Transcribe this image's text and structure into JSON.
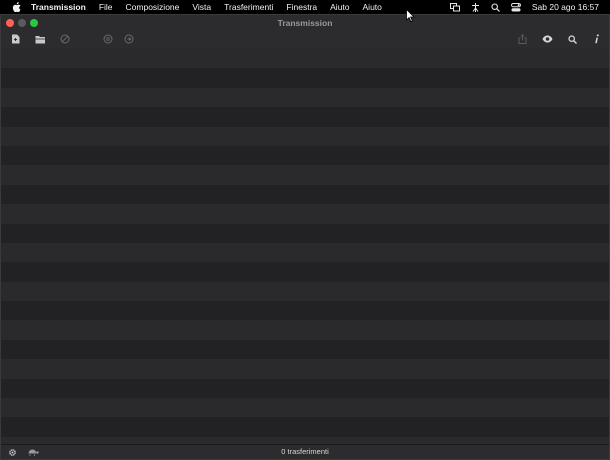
{
  "menubar": {
    "app_name": "Transmission",
    "menus": [
      "File",
      "Composizione",
      "Vista",
      "Trasferimenti",
      "Finestra",
      "Aiuto",
      "Aiuto"
    ],
    "clock": "Sab 20 ago  16:57",
    "status_icons": [
      "screen-mirroring-icon",
      "accessibility-icon",
      "spotlight-search-icon",
      "control-center-icon"
    ]
  },
  "window": {
    "title": "Transmission",
    "toolbar_left": [
      "create-torrent-icon",
      "open-torrent-icon",
      "remove-icon",
      "pause-all-icon",
      "resume-all-icon"
    ],
    "toolbar_right": [
      "share-icon",
      "quick-look-icon",
      "search-icon",
      "info-icon"
    ]
  },
  "list": {
    "row_count": 0
  },
  "statusbar": {
    "text": "0 trasferimenti",
    "left_icons": [
      "gear-icon",
      "turtle-speed-limit-icon"
    ]
  },
  "colors": {
    "window_bg": "#232325",
    "row_odd": "#2a2a2c",
    "row_even": "#222224",
    "close": "#ff5f57",
    "zoom": "#28c840"
  }
}
